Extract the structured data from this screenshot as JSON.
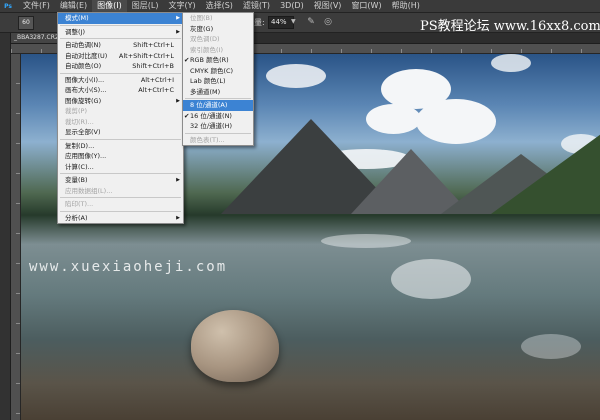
{
  "menubar": {
    "logo": "Ps",
    "items": [
      "文件(F)",
      "编辑(E)",
      "图像(I)",
      "图层(L)",
      "文字(Y)",
      "选择(S)",
      "滤镜(T)",
      "3D(D)",
      "视图(V)",
      "窗口(W)",
      "帮助(H)"
    ]
  },
  "options": {
    "tool_size": "60",
    "zoom_label": "量:",
    "zoom_value": "44%"
  },
  "watermark_top": "PS教程论坛 www.16xx8.com",
  "document_tab": "_BBA3287.CR2 @ 44% (RGB/8)",
  "canvas_watermark": "www.xuexiaoheji.com",
  "image_menu": [
    {
      "label": "模式(M)",
      "submenu": true,
      "highlighted": true
    },
    {
      "sep": true
    },
    {
      "label": "调整(J)",
      "submenu": true
    },
    {
      "sep": true
    },
    {
      "label": "自动色调(N)",
      "shortcut": "Shift+Ctrl+L"
    },
    {
      "label": "自动对比度(U)",
      "shortcut": "Alt+Shift+Ctrl+L"
    },
    {
      "label": "自动颜色(O)",
      "shortcut": "Shift+Ctrl+B"
    },
    {
      "sep": true
    },
    {
      "label": "图像大小(I)...",
      "shortcut": "Alt+Ctrl+I"
    },
    {
      "label": "画布大小(S)...",
      "shortcut": "Alt+Ctrl+C"
    },
    {
      "label": "图像旋转(G)",
      "submenu": true
    },
    {
      "label": "裁剪(P)",
      "disabled": true
    },
    {
      "label": "裁切(R)...",
      "disabled": true
    },
    {
      "label": "显示全部(V)"
    },
    {
      "sep": true
    },
    {
      "label": "复制(D)..."
    },
    {
      "label": "应用图像(Y)..."
    },
    {
      "label": "计算(C)..."
    },
    {
      "sep": true
    },
    {
      "label": "变量(B)",
      "submenu": true
    },
    {
      "label": "应用数据组(L)...",
      "disabled": true
    },
    {
      "sep": true
    },
    {
      "label": "陷印(T)...",
      "disabled": true
    },
    {
      "sep": true
    },
    {
      "label": "分析(A)",
      "submenu": true
    }
  ],
  "mode_menu": [
    {
      "label": "位图(B)",
      "disabled": true
    },
    {
      "label": "灰度(G)"
    },
    {
      "label": "双色调(D)",
      "disabled": true
    },
    {
      "label": "索引颜色(I)",
      "disabled": true
    },
    {
      "label": "RGB 颜色(R)",
      "checked": true
    },
    {
      "label": "CMYK 颜色(C)"
    },
    {
      "label": "Lab 颜色(L)"
    },
    {
      "label": "多通道(M)"
    },
    {
      "sep": true
    },
    {
      "label": "8 位/通道(A)",
      "highlighted": true
    },
    {
      "label": "16 位/通道(N)",
      "checked": true
    },
    {
      "label": "32 位/通道(H)"
    },
    {
      "sep": true
    },
    {
      "label": "颜色表(T)...",
      "disabled": true
    }
  ]
}
